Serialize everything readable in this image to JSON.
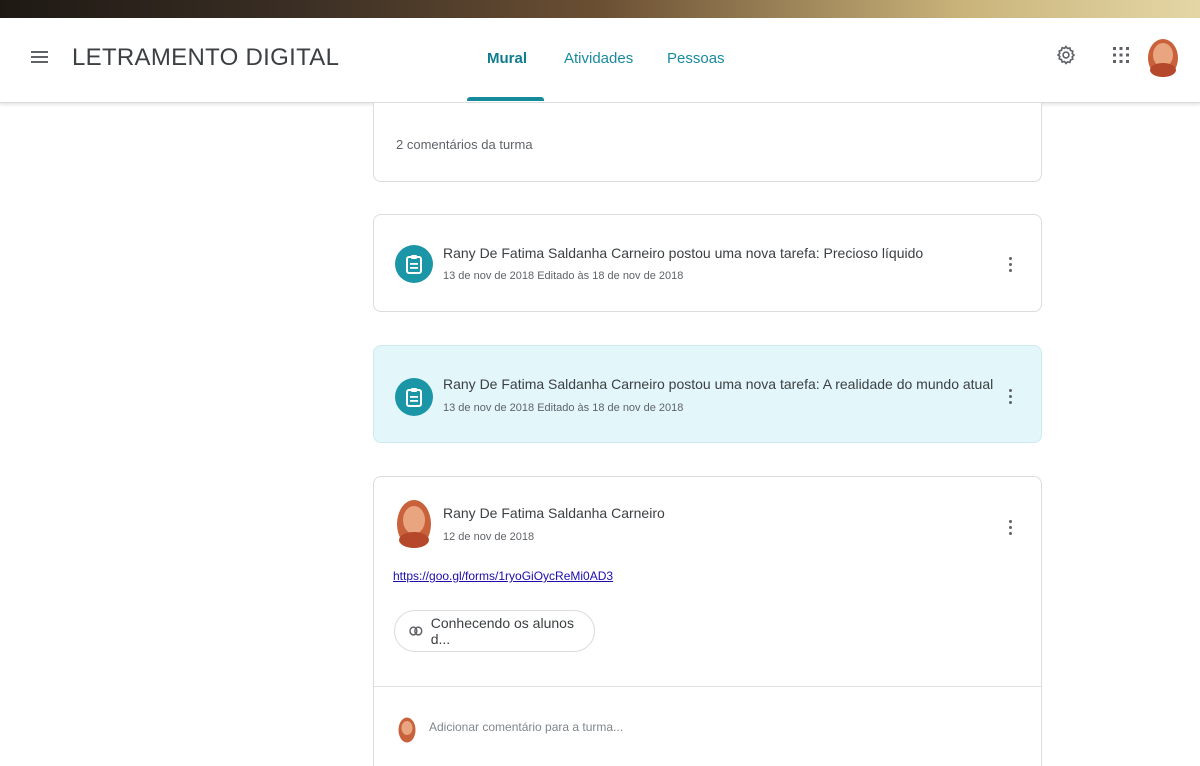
{
  "header": {
    "title": "LETRAMENTO DIGITAL",
    "tabs": [
      {
        "label": "Mural",
        "active": true
      },
      {
        "label": "Atividades",
        "active": false
      },
      {
        "label": "Pessoas",
        "active": false
      }
    ],
    "icons": [
      "menu-icon",
      "gear-icon",
      "apps-grid-icon",
      "user-avatar"
    ]
  },
  "colors": {
    "accent": "#1a8a9f",
    "assignment_icon_bg": "#1a96a6",
    "highlight_card_bg": "#e3f6fa",
    "link": "#1a0dab"
  },
  "feed": {
    "comments_count": "2 comentários da turma",
    "posts": [
      {
        "type": "assignment",
        "title": "Rany De Fatima Saldanha Carneiro postou uma nova tarefa: Precioso líquido",
        "meta": "13 de nov de 2018 Editado às 18 de nov de 2018",
        "icon": "assignment-icon"
      },
      {
        "type": "assignment",
        "highlighted": true,
        "title": "Rany De Fatima Saldanha Carneiro postou uma nova tarefa: A realidade do mundo atual",
        "meta": "13 de nov de 2018 Editado às 18 de nov de 2018",
        "icon": "assignment-icon"
      }
    ],
    "announcement": {
      "author": "Rany De Fatima Saldanha Carneiro",
      "date": "12 de nov de 2018",
      "link": "https://goo.gl/forms/1ryoGiOycReMi0AD3",
      "attachment_label": "Conhecendo os alunos d...",
      "comment_placeholder": "Adicionar comentário para a turma..."
    }
  }
}
